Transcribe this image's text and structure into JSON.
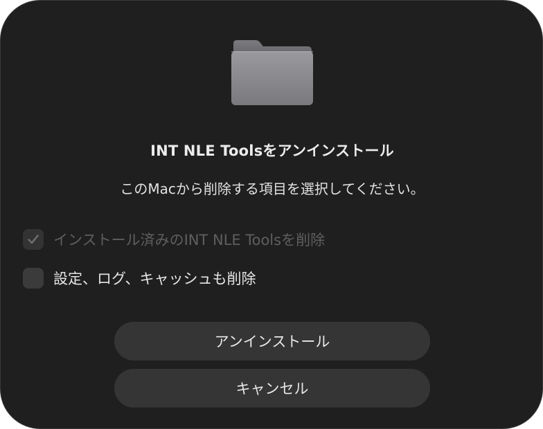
{
  "dialog": {
    "icon": "folder-icon",
    "title": "INT NLE Toolsをアンインストール",
    "subtitle": "このMacから削除する項目を選択してください。"
  },
  "options": [
    {
      "label": "インストール済みのINT NLE Toolsを削除",
      "checked": true,
      "enabled": false
    },
    {
      "label": "設定、ログ、キャッシュも削除",
      "checked": false,
      "enabled": true
    }
  ],
  "buttons": {
    "uninstall_label": "アンインストール",
    "cancel_label": "キャンセル"
  },
  "colors": {
    "dialog_background": "#1f1f1f",
    "button_background": "#353535",
    "checkbox_background": "#3b3b3b",
    "disabled_text": "#5f5f5f",
    "folder": "#8e8e93"
  }
}
